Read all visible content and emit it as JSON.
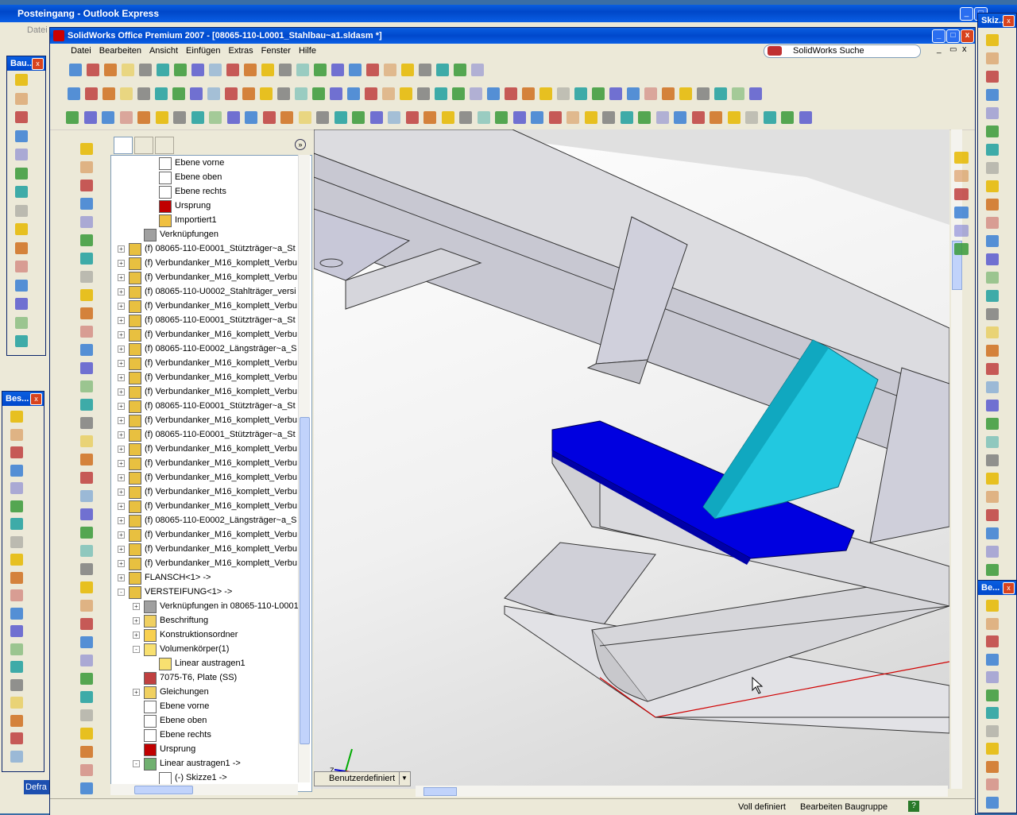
{
  "outlook": {
    "title": "Posteingang - Outlook Express",
    "menu_first": "Datei"
  },
  "sw": {
    "title": "SolidWorks Office Premium 2007 - [08065-110-L0001_Stahlbau~a1.sldasm *]",
    "menu": [
      "Datei",
      "Bearbeiten",
      "Ansicht",
      "Einfügen",
      "Extras",
      "Fenster",
      "Hilfe"
    ],
    "search_label": "SolidWorks Suche",
    "view_combo": "Benutzerdefiniert",
    "status": {
      "defined": "Voll definiert",
      "mode": "Bearbeiten Baugruppe"
    }
  },
  "panels": {
    "left_top": "Bau...",
    "left_bottom": "Bes...",
    "right_top": "Skiz...",
    "right_bottom": "Be..."
  },
  "taskbar_label": "Defra",
  "tree": [
    {
      "indent": 3,
      "icon": "plane",
      "text": "Ebene vorne",
      "exp": ""
    },
    {
      "indent": 3,
      "icon": "plane",
      "text": "Ebene oben",
      "exp": ""
    },
    {
      "indent": 3,
      "icon": "plane",
      "text": "Ebene rechts",
      "exp": ""
    },
    {
      "indent": 3,
      "icon": "origin",
      "text": "Ursprung",
      "exp": ""
    },
    {
      "indent": 3,
      "icon": "import",
      "text": "Importiert1",
      "exp": ""
    },
    {
      "indent": 2,
      "icon": "mate",
      "text": "Verknüpfungen",
      "exp": ""
    },
    {
      "indent": 1,
      "icon": "part",
      "text": "(f) 08065-110-E0001_Stützträger~a_St",
      "exp": "+"
    },
    {
      "indent": 1,
      "icon": "part",
      "text": "(f) Verbundanker_M16_komplett_Verbu",
      "exp": "+"
    },
    {
      "indent": 1,
      "icon": "part",
      "text": "(f) Verbundanker_M16_komplett_Verbu",
      "exp": "+"
    },
    {
      "indent": 1,
      "icon": "part",
      "text": "(f) 08065-110-U0002_Stahlträger_versi",
      "exp": "+"
    },
    {
      "indent": 1,
      "icon": "part",
      "text": "(f) Verbundanker_M16_komplett_Verbu",
      "exp": "+"
    },
    {
      "indent": 1,
      "icon": "part",
      "text": "(f) 08065-110-E0001_Stützträger~a_St",
      "exp": "+"
    },
    {
      "indent": 1,
      "icon": "part",
      "text": "(f) Verbundanker_M16_komplett_Verbu",
      "exp": "+"
    },
    {
      "indent": 1,
      "icon": "part",
      "text": "(f) 08065-110-E0002_Längsträger~a_S",
      "exp": "+"
    },
    {
      "indent": 1,
      "icon": "part",
      "text": "(f) Verbundanker_M16_komplett_Verbu",
      "exp": "+"
    },
    {
      "indent": 1,
      "icon": "part",
      "text": "(f) Verbundanker_M16_komplett_Verbu",
      "exp": "+"
    },
    {
      "indent": 1,
      "icon": "part",
      "text": "(f) Verbundanker_M16_komplett_Verbu",
      "exp": "+"
    },
    {
      "indent": 1,
      "icon": "part",
      "text": "(f) 08065-110-E0001_Stützträger~a_St",
      "exp": "+"
    },
    {
      "indent": 1,
      "icon": "part",
      "text": "(f) Verbundanker_M16_komplett_Verbu",
      "exp": "+"
    },
    {
      "indent": 1,
      "icon": "part",
      "text": "(f) 08065-110-E0001_Stützträger~a_St",
      "exp": "+"
    },
    {
      "indent": 1,
      "icon": "part",
      "text": "(f) Verbundanker_M16_komplett_Verbu",
      "exp": "+"
    },
    {
      "indent": 1,
      "icon": "part",
      "text": "(f) Verbundanker_M16_komplett_Verbu",
      "exp": "+"
    },
    {
      "indent": 1,
      "icon": "part",
      "text": "(f) Verbundanker_M16_komplett_Verbu",
      "exp": "+"
    },
    {
      "indent": 1,
      "icon": "part",
      "text": "(f) Verbundanker_M16_komplett_Verbu",
      "exp": "+"
    },
    {
      "indent": 1,
      "icon": "part",
      "text": "(f) Verbundanker_M16_komplett_Verbu",
      "exp": "+"
    },
    {
      "indent": 1,
      "icon": "part",
      "text": "(f) 08065-110-E0002_Längsträger~a_S",
      "exp": "+"
    },
    {
      "indent": 1,
      "icon": "part",
      "text": "(f) Verbundanker_M16_komplett_Verbu",
      "exp": "+"
    },
    {
      "indent": 1,
      "icon": "part",
      "text": "(f) Verbundanker_M16_komplett_Verbu",
      "exp": "+"
    },
    {
      "indent": 1,
      "icon": "part",
      "text": "(f) Verbundanker_M16_komplett_Verbu",
      "exp": "+"
    },
    {
      "indent": 1,
      "icon": "part",
      "text": "FLANSCH<1> ->",
      "exp": "+"
    },
    {
      "indent": 1,
      "icon": "part",
      "text": "VERSTEIFUNG<1> ->",
      "exp": "-"
    },
    {
      "indent": 2,
      "icon": "mate",
      "text": "Verknüpfungen in 08065-110-L0001",
      "exp": "+"
    },
    {
      "indent": 2,
      "icon": "annot",
      "text": "Beschriftung",
      "exp": "+"
    },
    {
      "indent": 2,
      "icon": "folder",
      "text": "Konstruktionsordner",
      "exp": "+"
    },
    {
      "indent": 2,
      "icon": "solid",
      "text": "Volumenkörper(1)",
      "exp": "-"
    },
    {
      "indent": 3,
      "icon": "solid",
      "text": "Linear austragen1",
      "exp": ""
    },
    {
      "indent": 2,
      "icon": "material",
      "text": "7075-T6, Plate (SS)",
      "exp": ""
    },
    {
      "indent": 2,
      "icon": "sigma",
      "text": "Gleichungen",
      "exp": "+"
    },
    {
      "indent": 2,
      "icon": "plane",
      "text": "Ebene vorne",
      "exp": ""
    },
    {
      "indent": 2,
      "icon": "plane",
      "text": "Ebene oben",
      "exp": ""
    },
    {
      "indent": 2,
      "icon": "plane",
      "text": "Ebene rechts",
      "exp": ""
    },
    {
      "indent": 2,
      "icon": "origin",
      "text": "Ursprung",
      "exp": ""
    },
    {
      "indent": 2,
      "icon": "extrude",
      "text": "Linear austragen1 ->",
      "exp": "-"
    },
    {
      "indent": 3,
      "icon": "sketch",
      "text": "(-) Skizze1 ->",
      "exp": ""
    }
  ],
  "colors": {
    "highlight_blue": "#0000e0",
    "highlight_cyan": "#22c8e0",
    "edge_red": "#d00000"
  }
}
